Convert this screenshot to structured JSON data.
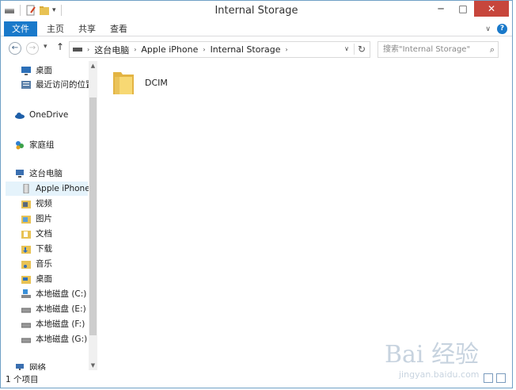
{
  "window": {
    "title": "Internal Storage",
    "min": "─",
    "max": "□",
    "close": "✕"
  },
  "ribbon": {
    "file_tab": "文件",
    "tabs": [
      "主页",
      "共享",
      "查看"
    ],
    "collapse": "∨",
    "help": "?"
  },
  "address": {
    "back": "←",
    "forward": "→",
    "recent": "▾",
    "up": "↑",
    "crumbs": [
      "这台电脑",
      "Apple iPhone",
      "Internal Storage"
    ],
    "chevron": "›",
    "dropdown": "∨",
    "refresh": "↻"
  },
  "search": {
    "placeholder": "搜索\"Internal Storage\"",
    "icon": "⌕"
  },
  "nav": {
    "items": [
      {
        "label": "桌面",
        "icon": "desktop-icon"
      },
      {
        "label": "最近访问的位置",
        "icon": "recent-places-icon"
      },
      {
        "label": "OneDrive",
        "icon": "onedrive-icon"
      },
      {
        "label": "家庭组",
        "icon": "homegroup-icon"
      },
      {
        "label": "这台电脑",
        "icon": "this-pc-icon"
      },
      {
        "label": "Apple iPhone",
        "icon": "iphone-icon"
      },
      {
        "label": "视频",
        "icon": "videos-folder-icon"
      },
      {
        "label": "图片",
        "icon": "pictures-folder-icon"
      },
      {
        "label": "文档",
        "icon": "documents-folder-icon"
      },
      {
        "label": "下载",
        "icon": "downloads-folder-icon"
      },
      {
        "label": "音乐",
        "icon": "music-folder-icon"
      },
      {
        "label": "桌面",
        "icon": "desktop-folder-icon"
      },
      {
        "label": "本地磁盘 (C:)",
        "icon": "system-drive-icon"
      },
      {
        "label": "本地磁盘 (E:)",
        "icon": "drive-icon"
      },
      {
        "label": "本地磁盘 (F:)",
        "icon": "drive-icon"
      },
      {
        "label": "本地磁盘 (G:)",
        "icon": "drive-icon"
      },
      {
        "label": "网络",
        "icon": "network-icon"
      }
    ]
  },
  "content": {
    "files": [
      {
        "name": "DCIM",
        "icon": "folder-icon"
      }
    ]
  },
  "status": {
    "text": "1 个项目"
  },
  "watermark": {
    "brand": "Bai 经验",
    "sub": "jingyan.baidu.com"
  },
  "colors": {
    "accent": "#1979ca",
    "close": "#c7463c",
    "selection": "#e5f3fb"
  }
}
